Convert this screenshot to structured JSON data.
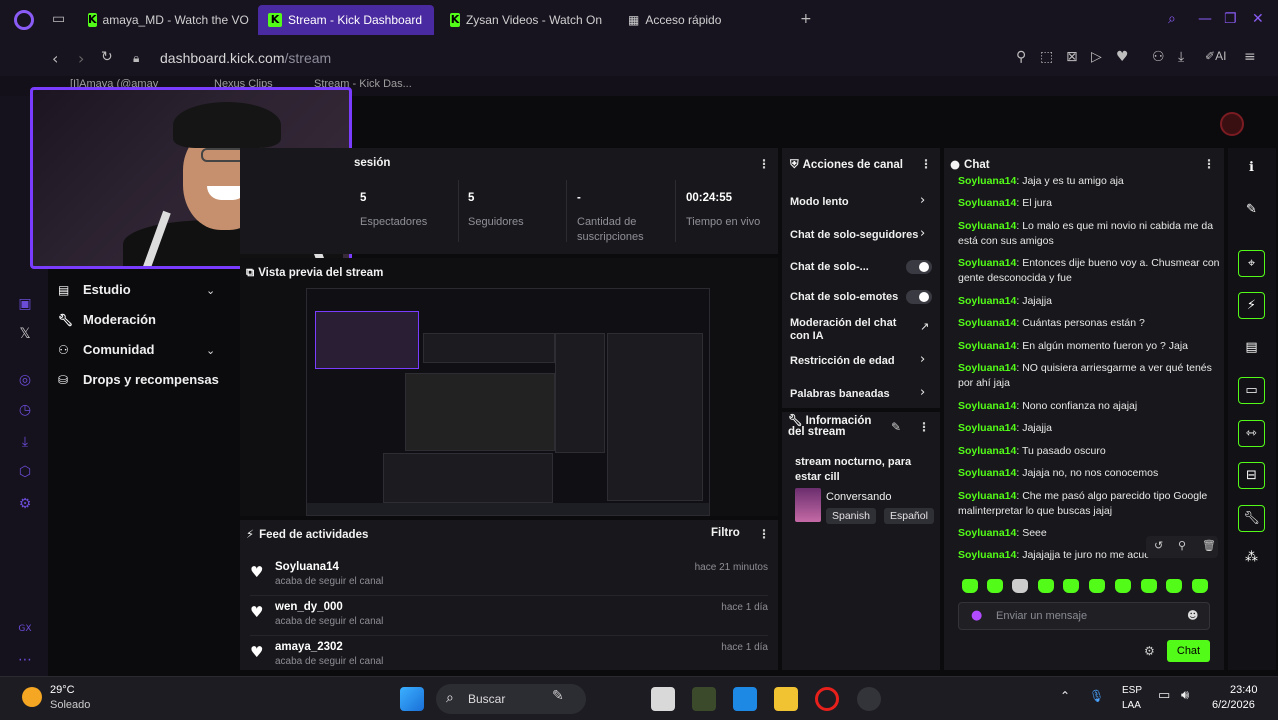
{
  "browser": {
    "tabs": [
      {
        "label": "amaya_MD - Watch the VO",
        "active": false,
        "icon": "kick-icon"
      },
      {
        "label": "Stream - Kick Dashboard",
        "active": true,
        "icon": "kick-icon"
      },
      {
        "label": "Zysan Videos - Watch On",
        "active": false,
        "icon": "kick-icon"
      },
      {
        "label": "Acceso rápido",
        "active": false,
        "icon": "speed-dial-icon"
      }
    ],
    "url_domain": "dashboard.kick.com",
    "url_path": "/stream",
    "bookmarks": [
      "[I]Amaya (@amay",
      "Nexus Clips",
      "Stream - Kick Das..."
    ],
    "ai_label": "AI"
  },
  "left_nav": {
    "items": [
      {
        "label": "Estudio",
        "icon": "studio-icon",
        "expandable": true
      },
      {
        "label": "Moderación",
        "icon": "wrench-icon",
        "expandable": false
      },
      {
        "label": "Comunidad",
        "icon": "community-icon",
        "expandable": true
      },
      {
        "label": "Drops y recompensas",
        "icon": "gift-icon",
        "expandable": false
      }
    ]
  },
  "session": {
    "title": "sesión",
    "stats": [
      {
        "value": "5",
        "label": "Espectadores"
      },
      {
        "value": "5",
        "label": "Seguidores"
      },
      {
        "value": "-",
        "label": "Cantidad de suscripciones"
      },
      {
        "value": "00:24:55",
        "label": "Tiempo en vivo"
      }
    ]
  },
  "preview": {
    "title": "Vista previa del stream"
  },
  "feed": {
    "title": "Feed de actividades",
    "filter_label": "Filtro",
    "items": [
      {
        "name": "Soyluana14",
        "action": "acaba de seguir el canal",
        "time": "hace 21 minutos"
      },
      {
        "name": "wen_dy_000",
        "action": "acaba de seguir el canal",
        "time": "hace 1 día"
      },
      {
        "name": "amaya_2302",
        "action": "acaba de seguir el canal",
        "time": "hace 1 día"
      }
    ]
  },
  "channel_actions": {
    "title": "Acciones de canal",
    "items": [
      {
        "label": "Modo lento",
        "control": "arrow"
      },
      {
        "label": "Chat de solo-seguidores",
        "control": "arrow"
      },
      {
        "label": "Chat de solo-...",
        "control": "toggle",
        "on": false
      },
      {
        "label": "Chat de solo-emotes",
        "control": "toggle",
        "on": false
      },
      {
        "label": "Moderación del chat con IA",
        "control": "external"
      },
      {
        "label": "Restricción de edad",
        "control": "arrow"
      },
      {
        "label": "Palabras baneadas",
        "control": "arrow"
      }
    ]
  },
  "stream_info": {
    "title": "Información del stream",
    "stream_title": "stream nocturno, para estar cill",
    "category": "Conversando",
    "tags": [
      "Spanish",
      "Español"
    ]
  },
  "chat": {
    "title": "Chat",
    "messages": [
      {
        "user": "Soyluana14",
        "text": "Jaja y es tu amigo aja"
      },
      {
        "user": "Soyluana14",
        "text": "El jura"
      },
      {
        "user": "Soyluana14",
        "text": "Lo malo es que mi novio ni cabida me da está con sus amigos"
      },
      {
        "user": "Soyluana14",
        "text": "Entonces dije bueno voy a. Chusmear con gente desconocida y fue"
      },
      {
        "user": "Soyluana14",
        "text": "Jajajja"
      },
      {
        "user": "Soyluana14",
        "text": "Cuántas personas están ?"
      },
      {
        "user": "Soyluana14",
        "text": "En algún momento fueron yo ? Jaja"
      },
      {
        "user": "Soyluana14",
        "text": "NO quisiera arriesgarme a ver qué tenés por ahí jaja"
      },
      {
        "user": "Soyluana14",
        "text": "Nono confianza no ajajaj"
      },
      {
        "user": "Soyluana14",
        "text": "Jajajja"
      },
      {
        "user": "Soyluana14",
        "text": "Tu pasado oscuro"
      },
      {
        "user": "Soyluana14",
        "text": "Jajaja no, no nos conocemos"
      },
      {
        "user": "Soyluana14",
        "text": "Che me pasó algo parecido tipo Google malinterpretar lo que buscas jajaj"
      },
      {
        "user": "Soyluana14",
        "text": "Seee"
      },
      {
        "user": "Soyluana14",
        "text": "Jajajajja te juro no me acuer..."
      }
    ],
    "input_placeholder": "Enviar un mensaje",
    "send_label": "Chat"
  },
  "taskbar": {
    "weather_temp": "29°C",
    "weather_desc": "Soleado",
    "search_label": "Buscar",
    "lang_1": "ESP",
    "lang_2": "LAA",
    "time": "23:40",
    "date": "6/2/2026"
  },
  "colors": {
    "accent_green": "#53fc18",
    "accent_purple": "#7a3cff",
    "panel_bg": "#18181c"
  }
}
